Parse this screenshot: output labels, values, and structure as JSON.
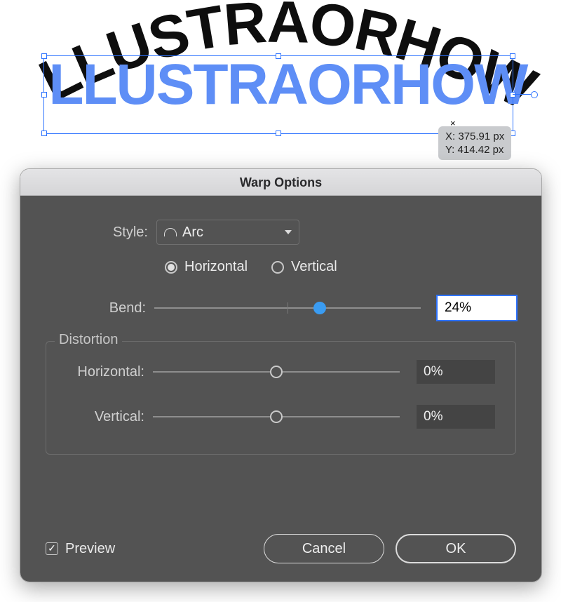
{
  "canvas": {
    "black_text": "ILLUSTRAORHOW",
    "blue_text": "ILLUSTRAORHOW",
    "cursor_glyph": "×",
    "coord_x_label": "X:",
    "coord_x_value": "375.91 px",
    "coord_y_label": "Y:",
    "coord_y_value": "414.42 px"
  },
  "dialog": {
    "title": "Warp Options",
    "style_label": "Style:",
    "style_value": "Arc",
    "orient_h": "Horizontal",
    "orient_v": "Vertical",
    "orient_selected": "Horizontal",
    "bend_label": "Bend:",
    "bend_value": "24%",
    "bend_pct": 24,
    "distortion_title": "Distortion",
    "dist_h_label": "Horizontal:",
    "dist_h_value": "0%",
    "dist_h_pct": 0,
    "dist_v_label": "Vertical:",
    "dist_v_value": "0%",
    "dist_v_pct": 0,
    "preview_label": "Preview",
    "preview_checked": true,
    "cancel": "Cancel",
    "ok": "OK"
  }
}
